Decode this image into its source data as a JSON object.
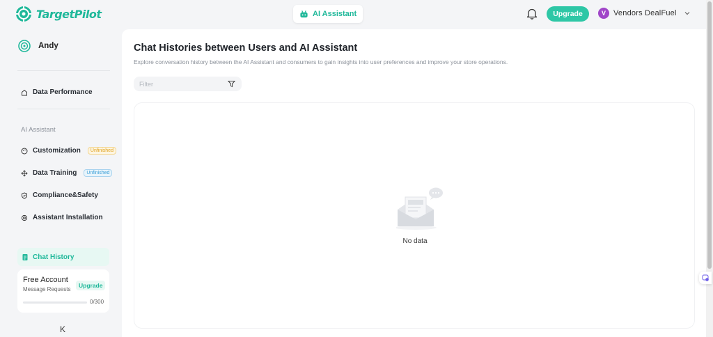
{
  "brand": {
    "name": "TargetPilot",
    "color": "#1fb89a"
  },
  "header": {
    "ai_tab_label": "AI Assistant",
    "upgrade_label": "Upgrade",
    "avatar_initial": "V",
    "account_name": "Vendors DealFuel"
  },
  "sidebar": {
    "user_name": "Andy",
    "data_performance": "Data Performance",
    "section_ai": "AI Assistant",
    "items": [
      {
        "label": "Customization",
        "badge": "Unfinished",
        "icon": "palette-icon"
      },
      {
        "label": "Data Training",
        "badge": "Unfinished",
        "icon": "move-icon"
      },
      {
        "label": "Compliance&Safety",
        "badge": "",
        "icon": "shield-icon"
      },
      {
        "label": "Assistant Installation",
        "badge": "",
        "icon": "settings-icon"
      }
    ],
    "active_item": "Chat History",
    "plan": {
      "title": "Free Account",
      "subtitle": "Message Requests",
      "upgrade": "Upgrade",
      "count": "0/300",
      "progress": 0
    },
    "collapse_glyph": "K"
  },
  "main": {
    "title": "Chat Histories between Users and AI Assistant",
    "description": "Explore conversation history between the AI Assistant and consumers to gain insights into user preferences and improve your store operations.",
    "filter_placeholder": "Filter",
    "empty_text": "No data"
  },
  "colors": {
    "accent": "#2ec7a6",
    "active_bg": "#e7f8f3",
    "avatar": "#a046c8"
  }
}
